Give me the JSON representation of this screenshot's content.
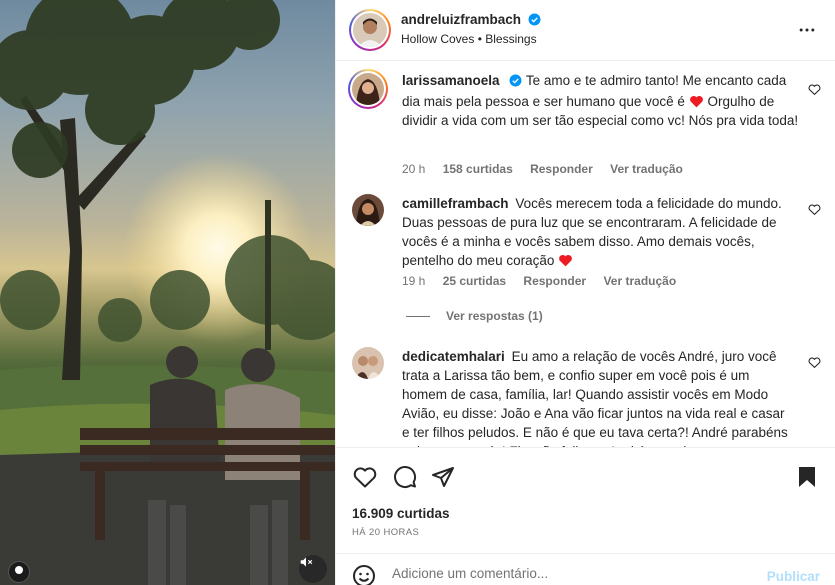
{
  "post": {
    "username": "andreluizframbach",
    "verified": true,
    "subtitle": "Hollow Coves • Blessings"
  },
  "comments": [
    {
      "username": "larissamanoela",
      "verified": true,
      "text": "Te amo e te admiro tanto! Me encanto cada dia mais pela pessoa e ser humano que você é",
      "text_after_heart": " Orgulho de dividir a vida com um ser tão especial como vc! Nós pra vida toda!",
      "time": "20 h",
      "likes": "158 curtidas",
      "reply": "Responder",
      "translate": "Ver tradução"
    },
    {
      "username": "camilleframbach",
      "verified": false,
      "text": "Vocês merecem toda a felicidade do mundo. Duas pessoas de pura luz que se encontraram. A felicidade de vocês é a minha e vocês sabem disso. Amo demais vocês, pentelho do meu coração",
      "time": "19 h",
      "likes": "25 curtidas",
      "reply": "Responder",
      "translate": "Ver tradução",
      "view_replies": "Ver respostas (1)"
    },
    {
      "username": "dedicatemhalari",
      "verified": false,
      "text": "Eu amo a relação de vocês André, juro você trata a Larissa tão bem, e confio super em você pois é um homem de casa, família, lar! Quando assistir vocês em Modo Avião, eu disse: João e Ana vão ficar juntos na vida real e casar e ter filhos peludos. E não é que eu tava certa?! André parabéns pela cara que és! Fico tão feliz e a Lari é sortuda por"
    }
  ],
  "footer": {
    "likes_count": "16.909 curtidas",
    "timestamp": "HÁ 20 HORAS",
    "comment_placeholder": "Adicione um comentário...",
    "publish_label": "Publicar"
  },
  "colors": {
    "heart_red": "#ed1c24",
    "verified_blue": "#0095f6",
    "publish_disabled": "#b2dffc",
    "meta_gray": "#737373"
  },
  "icons": [
    "more-options-icon",
    "heart-icon",
    "comment-icon",
    "share-icon",
    "bookmark-icon",
    "emoji-icon",
    "mute-icon",
    "verified-icon"
  ]
}
